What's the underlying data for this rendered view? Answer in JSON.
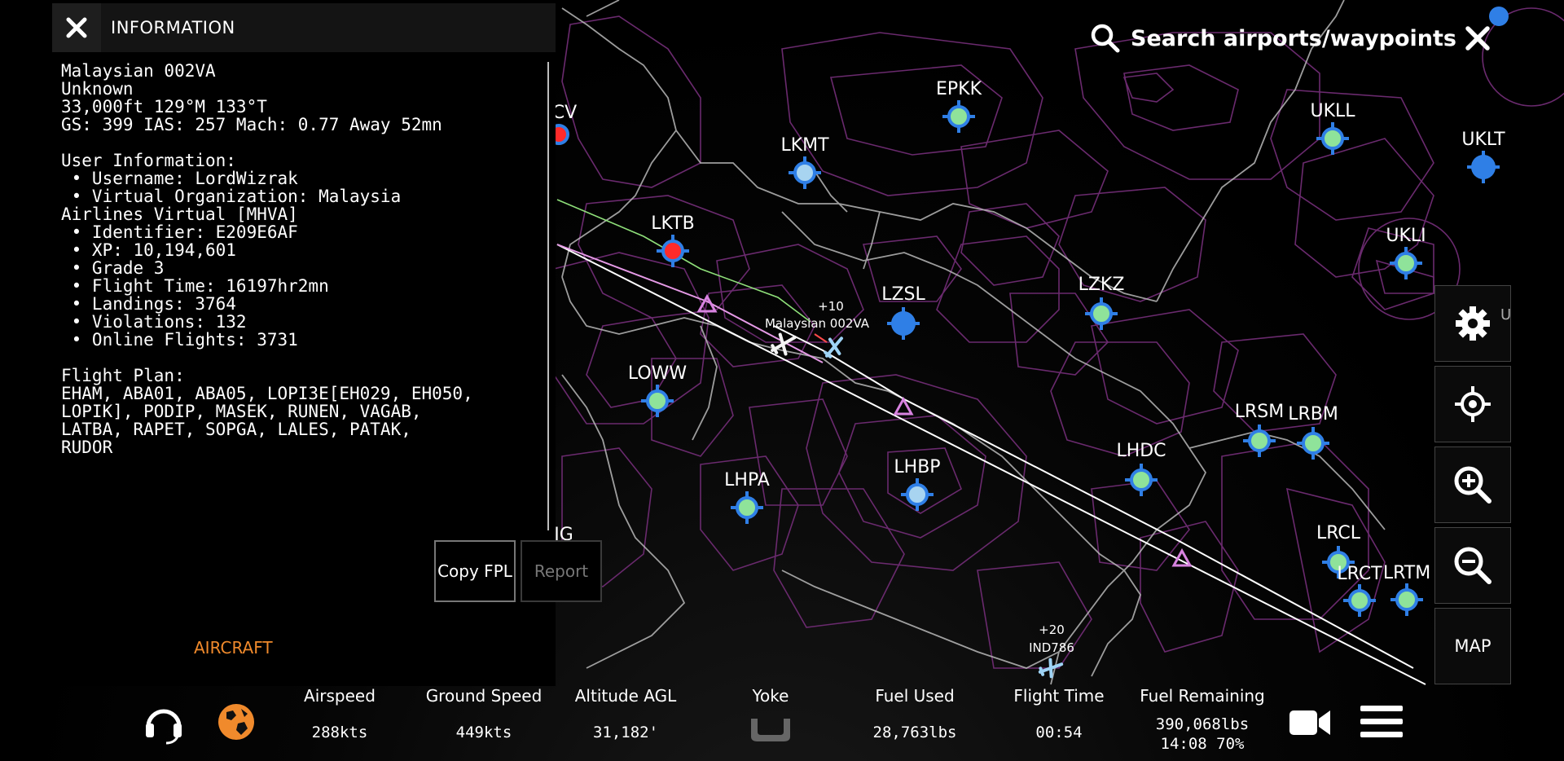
{
  "info_panel": {
    "title": "INFORMATION",
    "lines": [
      "Malaysian 002VA",
      "Unknown",
      "33,000ft 129°M 133°T",
      "GS: 399 IAS: 257 Mach: 0.77 Away 52mn",
      "",
      "User Information:",
      " • Username: LordWizrak",
      " • Virtual Organization: Malaysia",
      "Airlines Virtual [MHVA]",
      " • Identifier: E209E6AF",
      " • XP: 10,194,601",
      " • Grade 3",
      " • Flight Time: 16197hr2mn",
      " • Landings: 3764",
      " • Violations: 132",
      " • Online Flights: 3731",
      "",
      "Flight Plan:",
      "EHAM, ABA01, ABA05, LOPI3E[EH029, EH050,",
      "LOPIK], PODIP, MASEK, RUNEN, VAGAB,",
      "LATBA, RAPET, SOPGA, LALES, PATAK,",
      "RUDOR"
    ],
    "copy_button": "Copy FPL",
    "report_button": "Report",
    "aircraft_tab": "AIRCRAFT"
  },
  "search": {
    "label": "Search airports/waypoints",
    "icon": "search-icon"
  },
  "side_buttons": [
    {
      "name": "settings-button",
      "icon": "gear-icon"
    },
    {
      "name": "center-button",
      "icon": "crosshair-icon"
    },
    {
      "name": "zoom-in-button",
      "icon": "zoom-in-icon"
    },
    {
      "name": "zoom-out-button",
      "icon": "zoom-out-icon"
    },
    {
      "name": "map-button",
      "label": "MAP"
    }
  ],
  "map": {
    "airports": [
      {
        "code": "EPKK",
        "fill": "green"
      },
      {
        "code": "LKMT",
        "fill": "lightblue"
      },
      {
        "code": "LKTB",
        "fill": "red"
      },
      {
        "code": "LZSL",
        "fill": "blue"
      },
      {
        "code": "LZKZ",
        "fill": "green"
      },
      {
        "code": "LOWW",
        "fill": "green"
      },
      {
        "code": "LHPA",
        "fill": "green"
      },
      {
        "code": "LHBP",
        "fill": "lightblue"
      },
      {
        "code": "LHDC",
        "fill": "green"
      },
      {
        "code": "LRSM",
        "fill": "green"
      },
      {
        "code": "LRBM",
        "fill": "green"
      },
      {
        "code": "LRCL",
        "fill": "green"
      },
      {
        "code": "LRCT",
        "fill": "green"
      },
      {
        "code": "LRTM",
        "fill": "green"
      },
      {
        "code": "UKLL",
        "fill": "green"
      },
      {
        "code": "UKLT",
        "fill": "blue"
      },
      {
        "code": "UKLI",
        "fill": "green"
      }
    ],
    "partial_labels": [
      "CV",
      "IG",
      "U"
    ],
    "aircraft": [
      {
        "callsign": "Malaysian 002VA",
        "alt_delta": "+10"
      },
      {
        "callsign": "IND786",
        "alt_delta": "+20"
      }
    ],
    "colors": {
      "airspace": "#6a2a6e",
      "border": "#b8b8b8",
      "route": "#ffffff",
      "flown_track": "#8fe07a",
      "plan_route": "#e59ae6",
      "waypoint": "#d883e0",
      "airport_ring": "#2f7fe6",
      "green_fill": "#8fe39a",
      "lightblue_fill": "#a8d4f0",
      "red_fill": "#ff2a2a",
      "blue_fill": "#2f7fe6"
    }
  },
  "bottom_bar": {
    "airspeed": {
      "label": "Airspeed",
      "value": "288kts"
    },
    "ground_speed": {
      "label": "Ground Speed",
      "value": "449kts"
    },
    "altitude": {
      "label": "Altitude AGL",
      "value": "31,182'"
    },
    "yoke": {
      "label": "Yoke"
    },
    "fuel_used": {
      "label": "Fuel Used",
      "value": "28,763lbs"
    },
    "flight_time": {
      "label": "Flight Time",
      "value": "00:54"
    },
    "fuel_remaining": {
      "label": "Fuel Remaining",
      "value": "390,068lbs",
      "value2": "14:08 70%"
    },
    "icons": [
      "headset-icon",
      "globe-icon",
      "video-camera-icon",
      "menu-icon"
    ]
  }
}
